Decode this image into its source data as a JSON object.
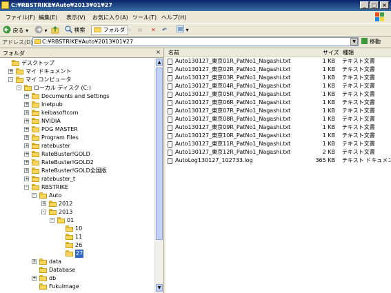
{
  "window": {
    "title": "C:¥RBSTRIKE¥Auto¥2013¥01¥27"
  },
  "menu": [
    "ファイル(F)",
    "編集(E)",
    "表示(V)",
    "お気に入り(A)",
    "ツール(T)",
    "ヘルプ(H)"
  ],
  "toolbar": {
    "back": "戻る",
    "search": "検索",
    "folders": "フォルダ"
  },
  "address": {
    "label": "アドレス(D)",
    "value": "C:¥RBSTRIKE¥Auto¥2013¥01¥27",
    "go": "移動"
  },
  "folder_pane": {
    "title": "フォルダ",
    "close": "×"
  },
  "tree": [
    {
      "label": "デスクトップ",
      "depth": 0,
      "exp": ""
    },
    {
      "label": "マイ ドキュメント",
      "depth": 1,
      "exp": "+"
    },
    {
      "label": "マイ コンピュータ",
      "depth": 1,
      "exp": "−"
    },
    {
      "label": "ローカル ディスク (C:)",
      "depth": 2,
      "exp": "−"
    },
    {
      "label": "Documents and Settings",
      "depth": 3,
      "exp": "+"
    },
    {
      "label": "Inetpub",
      "depth": 3,
      "exp": "+"
    },
    {
      "label": "keibasoftcom",
      "depth": 3,
      "exp": "+"
    },
    {
      "label": "NVIDIA",
      "depth": 3,
      "exp": "+"
    },
    {
      "label": "POG MASTER",
      "depth": 3,
      "exp": "+"
    },
    {
      "label": "Program Files",
      "depth": 3,
      "exp": "+"
    },
    {
      "label": "ratebuster",
      "depth": 3,
      "exp": "+"
    },
    {
      "label": "RateBuster!GOLD",
      "depth": 3,
      "exp": "+"
    },
    {
      "label": "RateBuster!GOLD2",
      "depth": 3,
      "exp": "+"
    },
    {
      "label": "RateBuster!GOLD全国版",
      "depth": 3,
      "exp": "+"
    },
    {
      "label": "ratebuster_t",
      "depth": 3,
      "exp": "+"
    },
    {
      "label": "RBSTRIKE",
      "depth": 3,
      "exp": "−"
    },
    {
      "label": "Auto",
      "depth": 4,
      "exp": "−"
    },
    {
      "label": "2012",
      "depth": 5,
      "exp": "+"
    },
    {
      "label": "2013",
      "depth": 5,
      "exp": "−"
    },
    {
      "label": "01",
      "depth": 6,
      "exp": "−"
    },
    {
      "label": "10",
      "depth": 7,
      "exp": ""
    },
    {
      "label": "11",
      "depth": 7,
      "exp": ""
    },
    {
      "label": "26",
      "depth": 7,
      "exp": ""
    },
    {
      "label": "27",
      "depth": 7,
      "exp": "",
      "selected": true
    },
    {
      "label": "data",
      "depth": 4,
      "exp": "+"
    },
    {
      "label": "Database",
      "depth": 4,
      "exp": ""
    },
    {
      "label": "db",
      "depth": 4,
      "exp": "+"
    },
    {
      "label": "FukuImage",
      "depth": 4,
      "exp": ""
    }
  ],
  "columns": {
    "name": "名前",
    "size": "サイズ",
    "type": "種類"
  },
  "files": [
    {
      "name": "Auto130127_東京01R_PatNo1_Nagashi.txt",
      "size": "1 KB",
      "type": "テキスト文書"
    },
    {
      "name": "Auto130127_東京02R_PatNo1_Nagashi.txt",
      "size": "1 KB",
      "type": "テキスト文書"
    },
    {
      "name": "Auto130127_東京03R_PatNo1_Nagashi.txt",
      "size": "1 KB",
      "type": "テキスト文書"
    },
    {
      "name": "Auto130127_東京04R_PatNo1_Nagashi.txt",
      "size": "1 KB",
      "type": "テキスト文書"
    },
    {
      "name": "Auto130127_東京05R_PatNo1_Nagashi.txt",
      "size": "1 KB",
      "type": "テキスト文書"
    },
    {
      "name": "Auto130127_東京06R_PatNo1_Nagashi.txt",
      "size": "1 KB",
      "type": "テキスト文書"
    },
    {
      "name": "Auto130127_東京07R_PatNo1_Nagashi.txt",
      "size": "1 KB",
      "type": "テキスト文書"
    },
    {
      "name": "Auto130127_東京08R_PatNo1_Nagashi.txt",
      "size": "1 KB",
      "type": "テキスト文書"
    },
    {
      "name": "Auto130127_東京09R_PatNo1_Nagashi.txt",
      "size": "1 KB",
      "type": "テキスト文書"
    },
    {
      "name": "Auto130127_東京10R_PatNo1_Nagashi.txt",
      "size": "1 KB",
      "type": "テキスト文書"
    },
    {
      "name": "Auto130127_東京11R_PatNo1_Nagashi.txt",
      "size": "1 KB",
      "type": "テキスト文書"
    },
    {
      "name": "Auto130127_東京12R_PatNo1_Nagashi.txt",
      "size": "2 KB",
      "type": "テキスト文書"
    },
    {
      "name": "AutoLog130127_102733.log",
      "size": "365 KB",
      "type": "テキスト ドキュメント"
    }
  ]
}
